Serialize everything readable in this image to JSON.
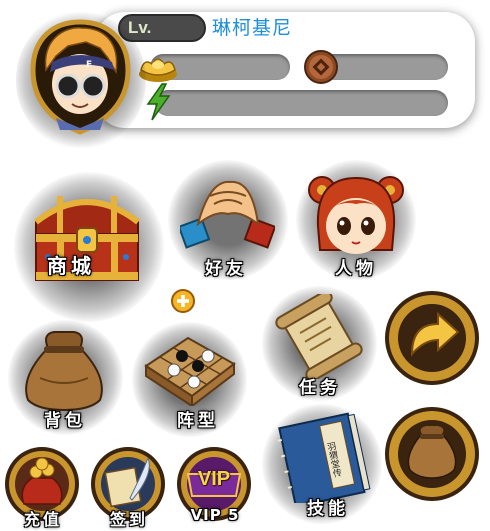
{
  "player": {
    "level_label": "Lv.",
    "name": "琳柯基尼",
    "vip_badge": "VIP",
    "vip_level": "VIP 5"
  },
  "menu": {
    "shop": "商城",
    "friends": "好友",
    "characters": "人物",
    "add": "+",
    "bag": "背包",
    "formation": "阵型",
    "quests": "任务",
    "skills": "技能",
    "recharge": "充值",
    "signin": "签到"
  },
  "book_title": "羽猬堂传",
  "icons": {
    "avatar": "player-avatar",
    "gold": "gold-ingot-icon",
    "coin": "copper-coin-icon",
    "energy": "lightning-icon",
    "shop": "treasure-chest-icon",
    "friends": "handshake-icon",
    "characters": "girl-portrait-icon",
    "bag": "money-bag-icon",
    "formation": "go-board-icon",
    "quests": "scroll-icon",
    "skills": "book-icon",
    "recharge": "coin-bag-icon",
    "signin": "quill-scroll-icon",
    "vip": "vip-badge-icon",
    "next": "arrow-forward-icon",
    "pouch": "pouch-icon"
  },
  "colors": {
    "name": "#1f8fd8",
    "gold_frame": "#c9962d",
    "bar": "#9a9a9a",
    "energy_icon": "#4caf2a"
  }
}
